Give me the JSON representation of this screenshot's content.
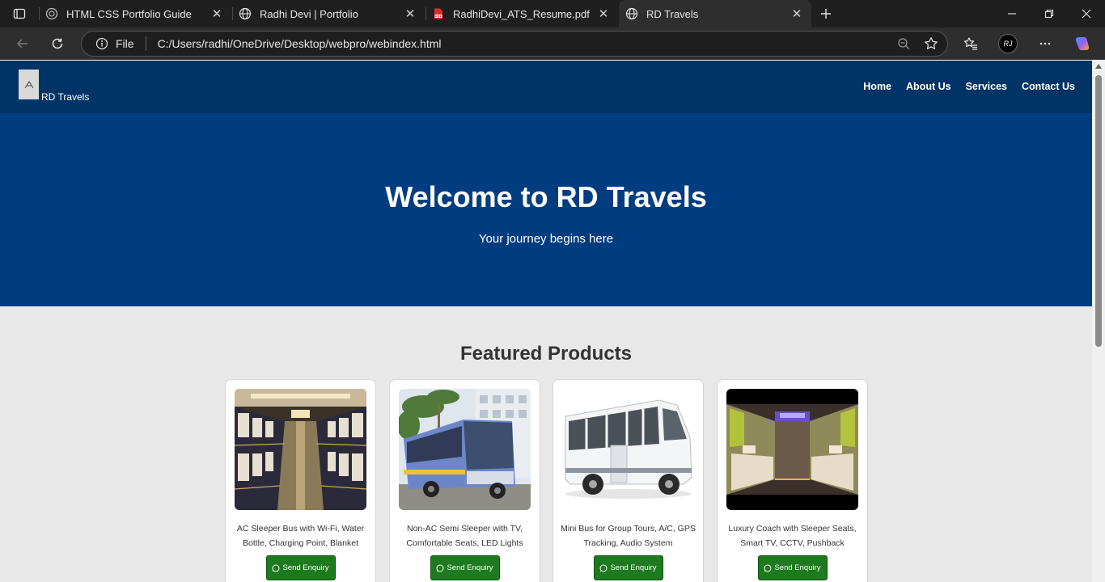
{
  "browser": {
    "tabs": [
      {
        "title": "HTML CSS Portfolio Guide",
        "icon": "chatgpt-icon"
      },
      {
        "title": "Radhi Devi | Portfolio",
        "icon": "globe-icon"
      },
      {
        "title": "RadhiDevi_ATS_Resume.pdf",
        "icon": "pdf-icon"
      },
      {
        "title": "RD Travels",
        "icon": "globe-icon",
        "active": true
      }
    ],
    "address": {
      "scheme": "File",
      "url": "C:/Users/radhi/OneDrive/Desktop/webpro/webindex.html"
    },
    "profile_initials": "RJ"
  },
  "site": {
    "logo_text": "RD Travels",
    "nav": [
      "Home",
      "About Us",
      "Services",
      "Contact Us"
    ],
    "hero": {
      "title": "Welcome to RD Travels",
      "subtitle": "Your journey begins here"
    },
    "products_heading": "Featured Products",
    "products": [
      {
        "desc": "AC Sleeper Bus with Wi-Fi, Water Bottle, Charging Point, Blanket",
        "button": "Send Enquiry"
      },
      {
        "desc": "Non-AC Semi Sleeper with TV, Comfortable Seats, LED Lights",
        "button": "Send Enquiry"
      },
      {
        "desc": "Mini Bus for Group Tours, A/C, GPS Tracking, Audio System",
        "button": "Send Enquiry"
      },
      {
        "desc": "Luxury Coach with Sleeper Seats, Smart TV, CCTV, Pushback",
        "button": "Send Enquiry"
      }
    ]
  },
  "colors": {
    "header": "#003366",
    "hero": "#003d80",
    "button": "#1e7a1e"
  }
}
